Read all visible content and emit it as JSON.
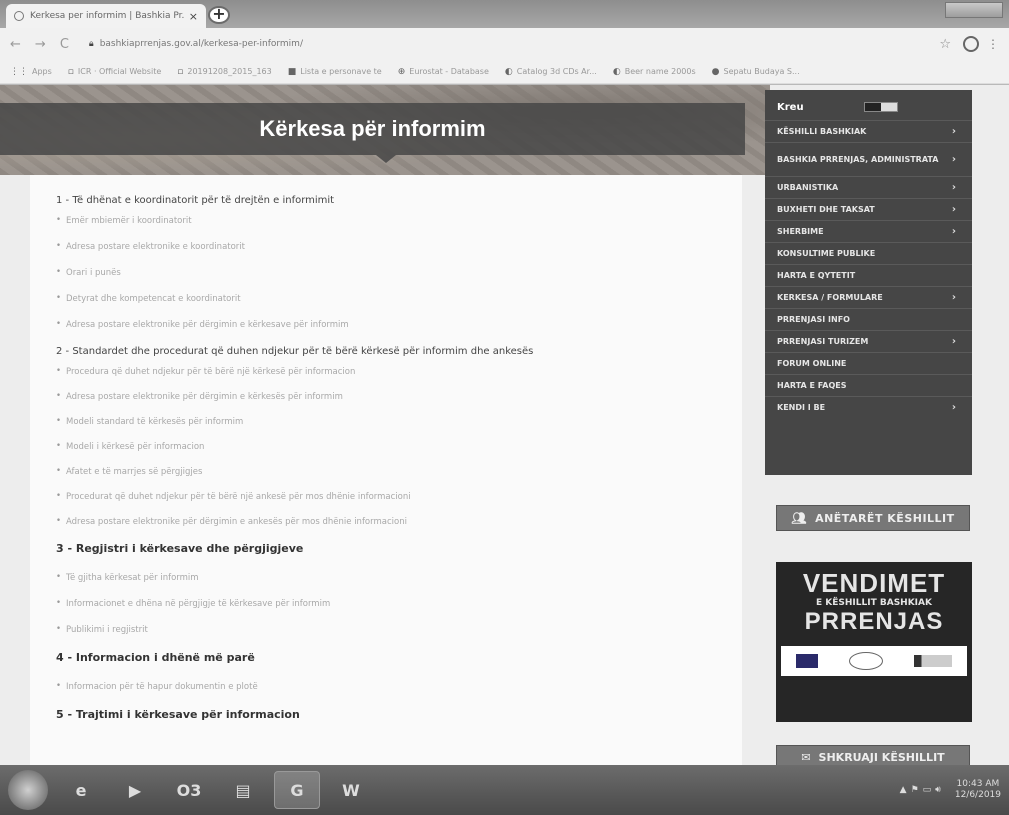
{
  "browser": {
    "tab_title": "Kerkesa per informim | Bashkia Pr...",
    "tab_close": "×",
    "new_tab": "+",
    "url": "bashkiaprrenjas.gov.al/kerkesa-per-informim/",
    "bookmarks": [
      "Apps",
      "ICR · Official Website",
      "20191208_2015_163",
      "Lista e personave te",
      "Eurostat - Database",
      "Catalog 3d CDs Ar...",
      "Beer name 2000s",
      "Sepatu Budaya S..."
    ]
  },
  "page": {
    "title": "Kërkesa për informim",
    "sections": [
      {
        "heading": "1 - Të dhënat e koordinatorit për të drejtën e informimit",
        "items": [
          "Emër mbiemër i koordinatorit",
          "Adresa postare elektronike e koordinatorit",
          "Orari i punës",
          "Detyrat dhe kompetencat e koordinatorit",
          "Adresa postare elektronike për dërgimin e kërkesave për informim"
        ]
      },
      {
        "heading": "2 - Standardet dhe procedurat që duhen ndjekur për të bërë kërkesë për informim dhe ankesës",
        "items": [
          "Procedura që duhet ndjekur për të bërë një kërkesë për informacion",
          "Adresa postare elektronike për dërgimin e kërkesës për informim",
          "Modeli standard të kërkesës për informim",
          "Modeli i kërkesë për informacion",
          "Afatet e të marrjes së përgjigjes",
          "Procedurat që duhet ndjekur për të bërë një ankesë për mos dhënie informacioni",
          "Adresa postare elektronike për dërgimin e ankesës për mos dhënie informacioni"
        ]
      },
      {
        "heading": "3 - Regjistri i kërkesave dhe përgjigjeve",
        "items": [
          "Të gjitha kërkesat për informim",
          "Informacionet e dhëna në përgjigje të kërkesave për informim",
          "Publikimi i regjistrit"
        ]
      },
      {
        "heading": "4 - Informacion i dhënë më parë",
        "items": [
          "Informacion për të hapur dokumentin e plotë"
        ]
      },
      {
        "heading": "5 - Trajtimi i kërkesave për informacion",
        "items": []
      }
    ]
  },
  "menu": {
    "heading": "Kreu",
    "items": [
      {
        "label": "KËSHILLI BASHKIAK",
        "arrow": "›"
      },
      {
        "label": "BASHKIA PRRENJAS, ADMINISTRATA",
        "arrow": "›"
      },
      {
        "label": "URBANISTIKA",
        "arrow": "›"
      },
      {
        "label": "BUXHETI DHE TAKSAT",
        "arrow": "›"
      },
      {
        "label": "SHERBIME",
        "arrow": "›"
      },
      {
        "label": "KONSULTIME PUBLIKE",
        "arrow": ""
      },
      {
        "label": "HARTA E QYTETIT",
        "arrow": ""
      },
      {
        "label": "KERKESA / FORMULARE",
        "arrow": "›"
      },
      {
        "label": "PRRENJASI INFO",
        "arrow": ""
      },
      {
        "label": "PRRENJASI TURIZEM",
        "arrow": "›"
      },
      {
        "label": "FORUM ONLINE",
        "arrow": ""
      },
      {
        "label": "HARTA E FAQES",
        "arrow": ""
      },
      {
        "label": "KENDI I BE",
        "arrow": "›"
      }
    ]
  },
  "banners": {
    "anetaret": "ANËTARËT KËSHILLIT",
    "vendimet_1": "VENDIMET",
    "vendimet_2": "E KËSHILLIT BASHKIAK",
    "vendimet_3": "PRRENJAS",
    "shkruaji": "SHKRUAJI KËSHILLIT"
  },
  "taskbar": {
    "apps": [
      "e",
      "▶",
      "O3",
      "▤",
      "G",
      "W"
    ],
    "time": "10:43 AM",
    "date": "12/6/2019"
  }
}
